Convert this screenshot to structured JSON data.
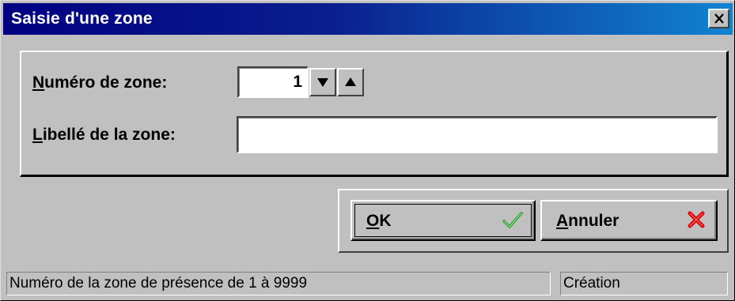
{
  "window": {
    "title": "Saisie d'une zone"
  },
  "form": {
    "zone_number": {
      "label_accel": "N",
      "label_rest": "uméro de zone:",
      "value": "1"
    },
    "zone_label": {
      "label_accel": "L",
      "label_rest": "ibellé de la zone:",
      "value": ""
    }
  },
  "buttons": {
    "ok": {
      "label_accel": "O",
      "label_rest": "K",
      "icon": "checkmark-icon"
    },
    "cancel": {
      "label_accel": "A",
      "label_rest": "nnuler",
      "icon": "red-x-icon"
    }
  },
  "statusbar": {
    "message": "Numéro de la zone de présence de 1 à 9999",
    "mode": "Création"
  },
  "colors": {
    "titlebar_start": "#000080",
    "titlebar_end": "#1084d0",
    "ok_check": "#2e9e2e",
    "cancel_x": "#e00000"
  }
}
